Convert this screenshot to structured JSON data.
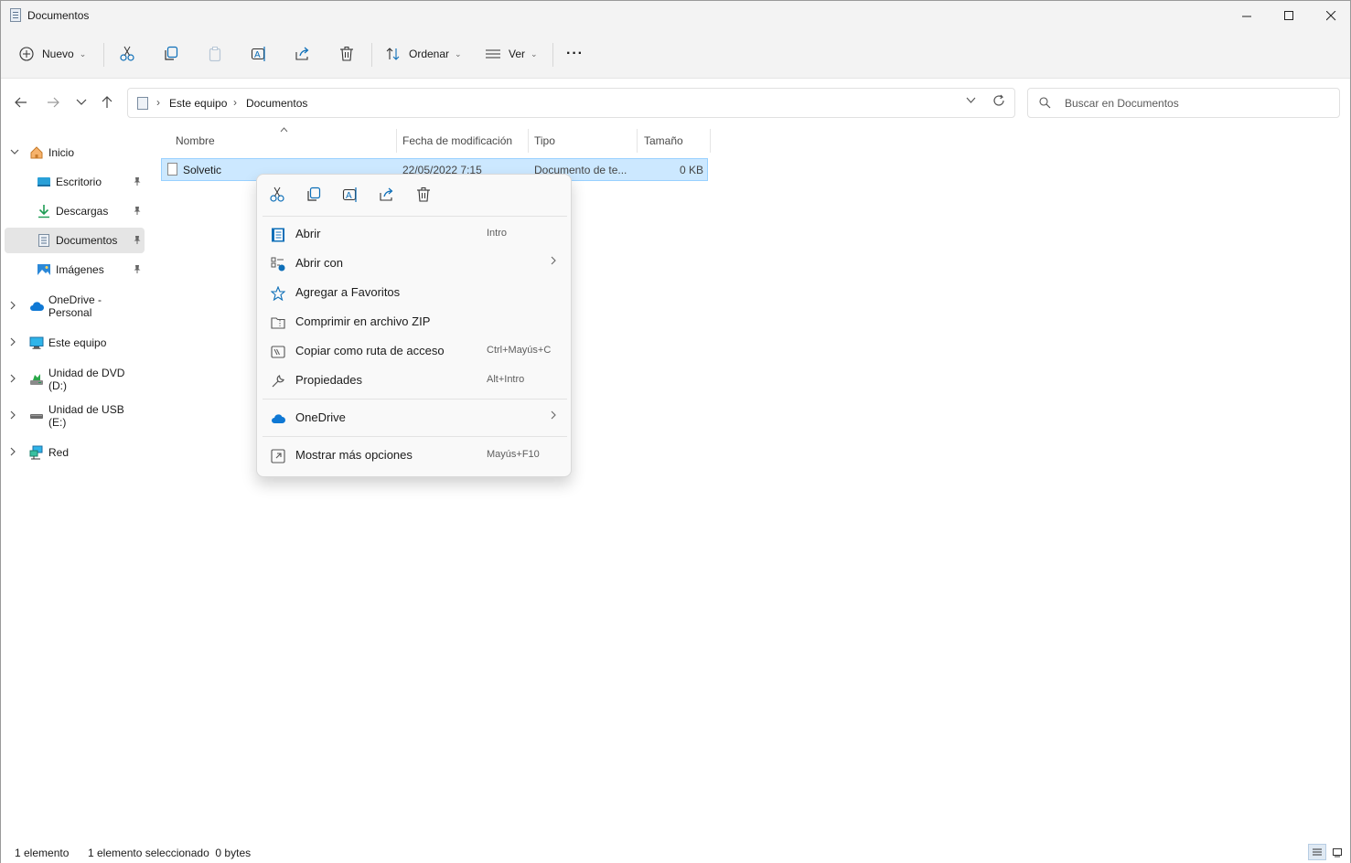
{
  "window": {
    "title": "Documentos"
  },
  "toolbar": {
    "new_label": "Nuevo",
    "sort_label": "Ordenar",
    "view_label": "Ver",
    "more_label": "···"
  },
  "address": {
    "crumbs": [
      "Este equipo",
      "Documentos"
    ],
    "search_placeholder": "Buscar en Documentos"
  },
  "sidebar": {
    "items": [
      {
        "label": "Inicio"
      },
      {
        "label": "Escritorio"
      },
      {
        "label": "Descargas"
      },
      {
        "label": "Documentos"
      },
      {
        "label": "Imágenes"
      },
      {
        "label": "OneDrive - Personal"
      },
      {
        "label": "Este equipo"
      },
      {
        "label": "Unidad de DVD (D:)"
      },
      {
        "label": "Unidad de USB (E:)"
      },
      {
        "label": "Red"
      }
    ]
  },
  "filelist": {
    "columns": [
      "Nombre",
      "Fecha de modificación",
      "Tipo",
      "Tamaño"
    ],
    "rows": [
      {
        "name": "Solvetic",
        "date": "22/05/2022 7:15",
        "type": "Documento de te...",
        "size": "0 KB"
      }
    ]
  },
  "context_menu": {
    "items": [
      {
        "label": "Abrir",
        "shortcut": "Intro"
      },
      {
        "label": "Abrir con",
        "shortcut": ""
      },
      {
        "label": "Agregar a Favoritos",
        "shortcut": ""
      },
      {
        "label": "Comprimir en archivo ZIP",
        "shortcut": ""
      },
      {
        "label": "Copiar como ruta de acceso",
        "shortcut": "Ctrl+Mayús+C"
      },
      {
        "label": "Propiedades",
        "shortcut": "Alt+Intro"
      },
      {
        "label": "OneDrive",
        "shortcut": ""
      },
      {
        "label": "Mostrar más opciones",
        "shortcut": "Mayús+F10"
      }
    ]
  },
  "status": {
    "count": "1 elemento",
    "selection": "1 elemento seleccionado  0 bytes"
  },
  "colors": {
    "accent": "#0067c0",
    "selection_bg": "#cce8ff",
    "selection_border": "#99d1ff"
  }
}
